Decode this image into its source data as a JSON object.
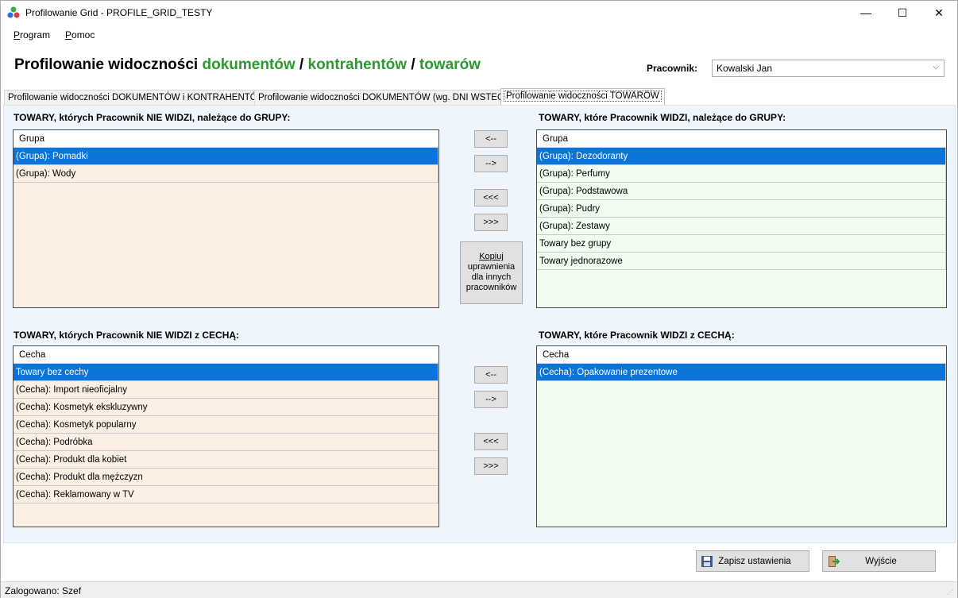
{
  "window": {
    "title": "Profilowanie Grid - PROFILE_GRID_TESTY",
    "minimize_glyph": "—",
    "maximize_glyph": "☐",
    "close_glyph": "✕"
  },
  "menu": {
    "items": [
      "Program",
      "Pomoc"
    ]
  },
  "heading": {
    "part1": "Profilowanie widoczności ",
    "part2": "dokumentów",
    "sep1": " / ",
    "part3": "kontrahentów",
    "sep2": " /  ",
    "part4": "towarów"
  },
  "employee": {
    "label": "Pracownik:",
    "value": "Kowalski Jan"
  },
  "tabs": [
    "Profilowanie widoczności DOKUMENTÓW i KONTRAHENTÓW",
    "Profilowanie widoczności DOKUMENTÓW (wg. DNI WSTECZ)",
    "Profilowanie widoczności TOWARÓW"
  ],
  "groups_hidden": {
    "label": "TOWARY, których Pracownik NIE WIDZI, należące do GRUPY:",
    "header": "Grupa",
    "rows": [
      "(Grupa): Pomadki",
      "(Grupa): Wody"
    ]
  },
  "groups_visible": {
    "label": "TOWARY, które Pracownik WIDZI, należące do GRUPY:",
    "header": "Grupa",
    "rows": [
      "(Grupa): Dezodoranty",
      "(Grupa): Perfumy",
      "(Grupa): Podstawowa",
      "(Grupa): Pudry",
      "(Grupa): Zestawy",
      "Towary bez grupy",
      "Towary jednorazowe"
    ]
  },
  "features_hidden": {
    "label": "TOWARY, których Pracownik NIE WIDZI z CECHĄ:",
    "header": "Cecha",
    "rows": [
      "Towary bez cechy",
      "(Cecha): Import nieoficjalny",
      "(Cecha): Kosmetyk ekskluzywny",
      "(Cecha): Kosmetyk popularny",
      "(Cecha): Podróbka",
      "(Cecha): Produkt dla kobiet",
      "(Cecha): Produkt dla mężczyzn",
      "(Cecha): Reklamowany w TV"
    ]
  },
  "features_visible": {
    "label": "TOWARY, które Pracownik WIDZI z CECHĄ:",
    "header": "Cecha",
    "rows": [
      "(Cecha): Opakowanie prezentowe"
    ]
  },
  "move_buttons": {
    "left": "<--",
    "right": "-->",
    "all_left": "<<<",
    "all_right": ">>>"
  },
  "copy_button": {
    "line1": "Kopiuj",
    "line2": "uprawnienia",
    "line3": "dla innych",
    "line4": "pracowników"
  },
  "save_button": {
    "label": "Zapisz ustawienia"
  },
  "exit_button": {
    "label": "Wyjście"
  },
  "status": {
    "text": "Zalogowano: Szef"
  },
  "colors": {
    "accent_green": "#2c9a2c",
    "selection": "#0a74d9",
    "hidden_bg": "#fbeee3",
    "visible_bg": "#effcef"
  }
}
